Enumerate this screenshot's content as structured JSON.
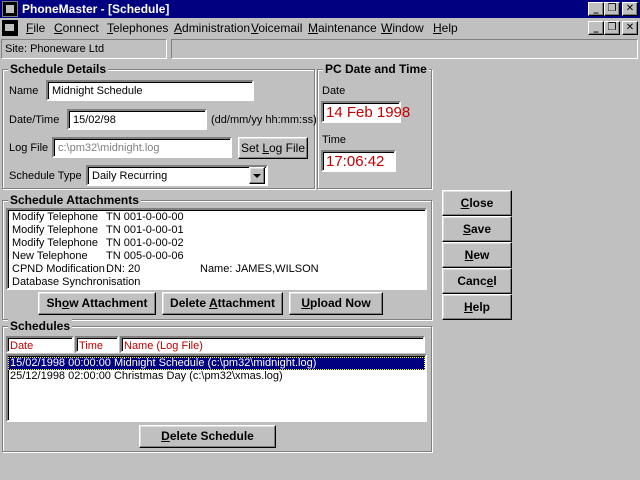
{
  "window": {
    "title": "PhoneMaster - [Schedule]"
  },
  "menu": {
    "items": [
      {
        "pre": "",
        "u": "F",
        "post": "ile"
      },
      {
        "pre": "",
        "u": "C",
        "post": "onnect"
      },
      {
        "pre": "",
        "u": "T",
        "post": "elephones"
      },
      {
        "pre": "",
        "u": "A",
        "post": "dministration"
      },
      {
        "pre": "",
        "u": "V",
        "post": "oicemail"
      },
      {
        "pre": "",
        "u": "M",
        "post": "aintenance"
      },
      {
        "pre": "",
        "u": "W",
        "post": "indow"
      },
      {
        "pre": "",
        "u": "H",
        "post": "elp"
      }
    ]
  },
  "site": {
    "label": "Site: Phoneware Ltd",
    "info": ""
  },
  "schedule_details": {
    "title": "Schedule Details",
    "name_label": "Name",
    "name_value": "Midnight Schedule",
    "datetime_label": "Date/Time",
    "datetime_value": "15/02/98",
    "datetime_hint": "(dd/mm/yy hh:mm:ss)",
    "logfile_label": "Log File",
    "logfile_value": "c:\\pm32\\midnight.log",
    "set_log_file": {
      "pre": "Set ",
      "u": "L",
      "post": "og File"
    },
    "type_label": "Schedule Type",
    "type_value": "Daily Recurring"
  },
  "pc_datetime": {
    "title": "PC Date and Time",
    "date_label": "Date",
    "date_value": "14 Feb 1998",
    "time_label": "Time",
    "time_value": "17:06:42"
  },
  "attachments": {
    "title": "Schedule Attachments",
    "rows": [
      {
        "a": "Modify Telephone",
        "b": "TN 001-0-00-00",
        "c": ""
      },
      {
        "a": "Modify Telephone",
        "b": "TN 001-0-00-01",
        "c": ""
      },
      {
        "a": "Modify Telephone",
        "b": "TN 001-0-00-02",
        "c": ""
      },
      {
        "a": "New Telephone",
        "b": "TN 005-0-00-06",
        "c": ""
      },
      {
        "a": "CPND Modification",
        "b": "DN: 20",
        "c": "Name: JAMES,WILSON"
      },
      {
        "a": "Database Synchronisation",
        "b": "",
        "c": ""
      }
    ],
    "show_btn": {
      "pre": "Sh",
      "u": "o",
      "post": "w Attachment"
    },
    "delete_btn": {
      "pre": "Delete ",
      "u": "A",
      "post": "ttachment"
    },
    "upload_btn": {
      "pre": "",
      "u": "U",
      "post": "pload Now"
    }
  },
  "side_buttons": [
    {
      "pre": "",
      "u": "C",
      "post": "lose"
    },
    {
      "pre": "",
      "u": "S",
      "post": "ave"
    },
    {
      "pre": "",
      "u": "N",
      "post": "ew"
    },
    {
      "pre": "Canc",
      "u": "e",
      "post": "l"
    },
    {
      "pre": "",
      "u": "H",
      "post": "elp"
    }
  ],
  "schedules": {
    "title": "Schedules",
    "headers": {
      "date": "Date",
      "time": "Time",
      "name": "Name     (Log File)"
    },
    "rows": [
      {
        "text": "15/02/1998  00:00:00  Midnight Schedule   (c:\\pm32\\midnight.log)",
        "selected": true
      },
      {
        "text": "25/12/1998  02:00:00  Christmas Day   (c:\\pm32\\xmas.log)",
        "selected": false
      }
    ],
    "delete_btn": {
      "pre": "",
      "u": "D",
      "post": "elete Schedule"
    }
  },
  "colors": {
    "titlebar": "#000080",
    "face": "#c0c0c0",
    "selection": "#000080",
    "red_text": "#c00000"
  }
}
